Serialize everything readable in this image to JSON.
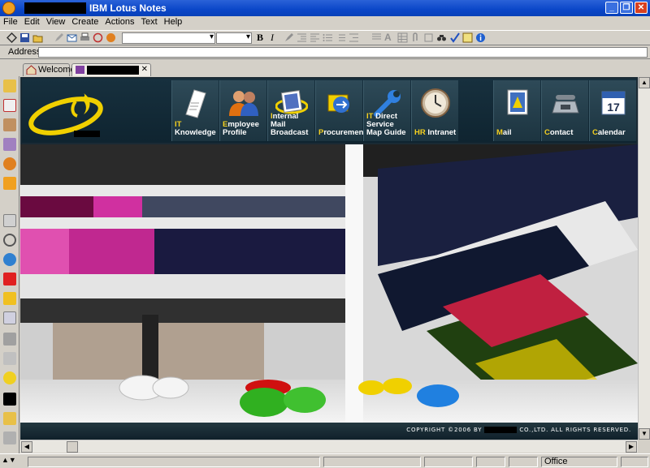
{
  "window": {
    "title": "IBM Lotus Notes"
  },
  "menu": [
    "File",
    "Edit",
    "View",
    "Create",
    "Actions",
    "Text",
    "Help"
  ],
  "address": {
    "label": "Address",
    "value": ""
  },
  "tabs": [
    {
      "label": "Welcome",
      "icon": "home-icon"
    },
    {
      "label": "",
      "icon": "page-icon"
    }
  ],
  "nav": [
    {
      "first": "IT",
      "rest": " Knowledge",
      "icon": "document-icon"
    },
    {
      "first": "E",
      "rest": "mployee",
      "line2": "Profile",
      "icon": "people-icon"
    },
    {
      "first": "I",
      "rest": "nternal Mail",
      "line2": "Broadcast",
      "icon": "stamp-icon"
    },
    {
      "first": "P",
      "rest": "rocurement",
      "icon": "cart-icon"
    },
    {
      "first": "IT",
      "rest": " Direct Service",
      "line2": "Map Guide",
      "icon": "wrench-icon"
    },
    {
      "first": "HR",
      "rest": " Intranet",
      "icon": "clock-icon"
    },
    {
      "first": "M",
      "rest": "ail",
      "icon": "mail-icon"
    },
    {
      "first": "C",
      "rest": "ontact",
      "icon": "phone-icon"
    },
    {
      "first": "C",
      "rest": "alendar",
      "icon": "calendar-icon"
    }
  ],
  "calendar_day": "17",
  "footer": {
    "copy_left": "COPYRIGHT ©2006 BY",
    "copy_right": "CO.,LTD. ALL RIGHTS RESERVED."
  },
  "status": {
    "location": "Office"
  },
  "colors": {
    "titlebar": "#0a46c8",
    "banner": "#17303e",
    "accent": "#f5d020"
  }
}
